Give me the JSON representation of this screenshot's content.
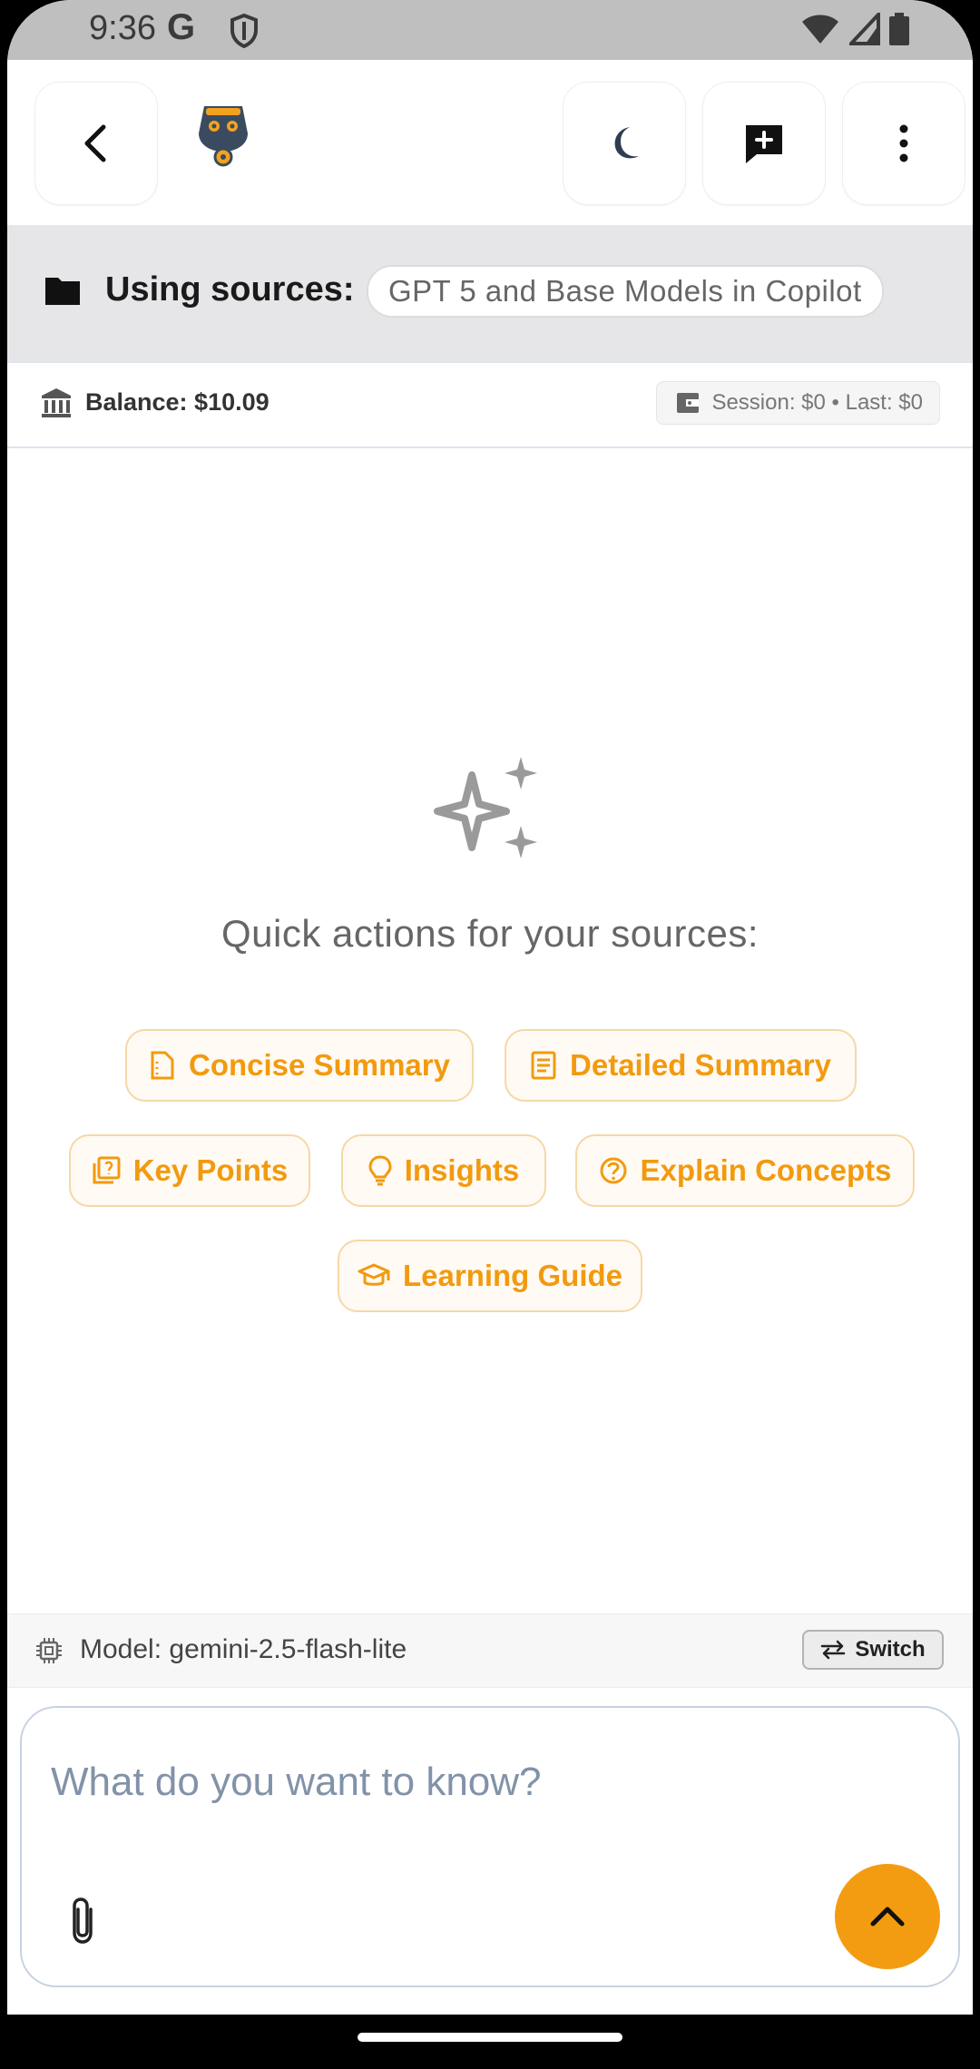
{
  "status_bar": {
    "time": "9:36",
    "google_glyph": "G",
    "icons": [
      "google-icon",
      "shield-icon",
      "wifi-icon",
      "signal-icon",
      "battery-icon"
    ]
  },
  "app_bar": {
    "back_icon": "chevron-left-icon",
    "avatar_icon": "robot-avatar-icon",
    "theme_icon": "moon-icon",
    "new_chat_icon": "chat-plus-icon",
    "menu_icon": "more-vertical-icon"
  },
  "sources": {
    "label": "Using sources:",
    "source_name": "GPT 5 and Base Models in Copilot"
  },
  "balance": {
    "text": "Balance: $10.09",
    "session_text": "Session: $0 • Last: $0"
  },
  "quick_actions": {
    "title": "Quick actions for your sources:",
    "buttons": [
      {
        "label": "Concise Summary",
        "icon": "document-icon"
      },
      {
        "label": "Detailed Summary",
        "icon": "list-document-icon"
      },
      {
        "label": "Key Points",
        "icon": "key-points-icon"
      },
      {
        "label": "Insights",
        "icon": "lightbulb-icon"
      },
      {
        "label": "Explain Concepts",
        "icon": "question-circle-icon"
      },
      {
        "label": "Learning Guide",
        "icon": "graduation-cap-icon"
      }
    ]
  },
  "model": {
    "text": "Model: gemini-2.5-flash-lite",
    "switch_label": "Switch"
  },
  "composer": {
    "placeholder": "What do you want to know?"
  },
  "colors": {
    "accent": "#f39c12",
    "accent_text": "#f29a0f",
    "sources_bg": "#e6e6e8"
  }
}
